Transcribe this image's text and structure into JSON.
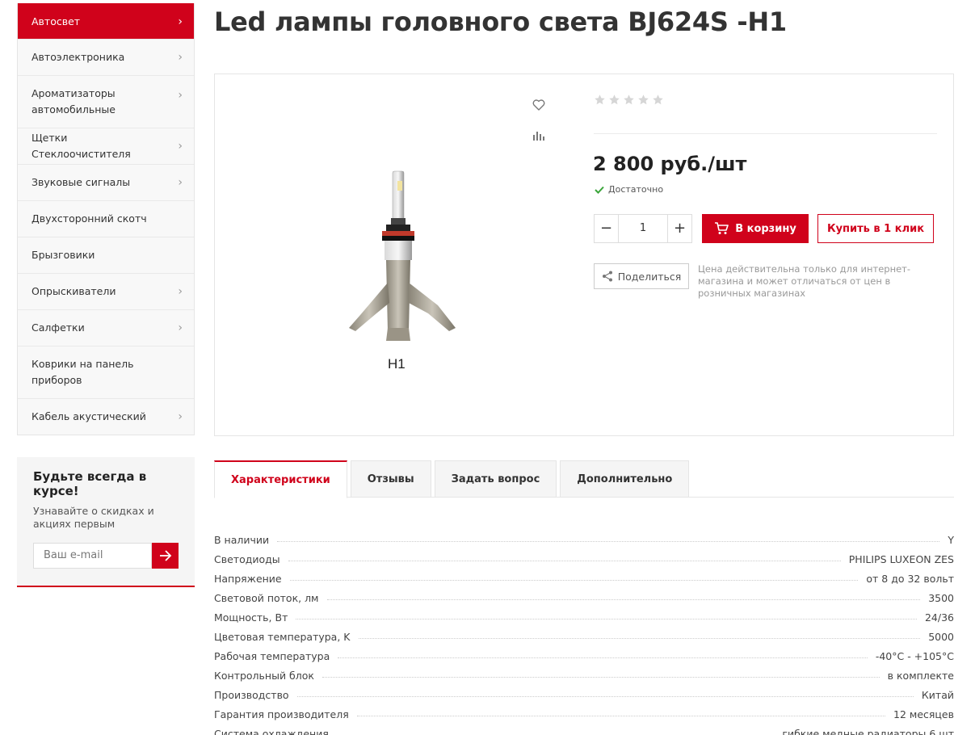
{
  "sidebar": {
    "menu": [
      {
        "label": "Автосвет",
        "active": true,
        "chevron": true
      },
      {
        "label": "Автоэлектроника",
        "chevron": true
      },
      {
        "label": "Ароматизаторы автомобильные",
        "chevron": true
      },
      {
        "label": "Щетки Стеклоочистителя",
        "chevron": true
      },
      {
        "label": "Звуковые сигналы",
        "chevron": true
      },
      {
        "label": "Двухсторонний скотч",
        "chevron": false
      },
      {
        "label": "Брызговики",
        "chevron": false
      },
      {
        "label": "Опрыскиватели",
        "chevron": true
      },
      {
        "label": "Салфетки",
        "chevron": true
      },
      {
        "label": "Коврики на панель приборов",
        "chevron": false
      },
      {
        "label": "Кабель акустический",
        "chevron": true
      }
    ],
    "subscribe": {
      "title": "Будьте всегда в курсе!",
      "text": "Узнавайте о скидках и акциях первым",
      "placeholder": "Ваш e-mail"
    }
  },
  "product": {
    "title": "Led лампы головного света BJ624S -H1",
    "image_label": "H1",
    "rating": 0,
    "rating_max": 5,
    "price": "2 800 руб./шт",
    "stock": "Достаточно",
    "quantity": "1",
    "cart_label": "В корзину",
    "oneclick_label": "Купить в 1 клик",
    "share_label": "Поделиться",
    "note": "Цена действительна только для интернет-магазина и может отличаться от цен в розничных магазинах"
  },
  "tabs": [
    {
      "label": "Характеристики",
      "active": true
    },
    {
      "label": "Отзывы"
    },
    {
      "label": "Задать вопрос"
    },
    {
      "label": "Дополнительно"
    }
  ],
  "specs": [
    {
      "label": "В наличии",
      "value": "Y"
    },
    {
      "label": "Светодиоды",
      "value": "PHILIPS LUXEON ZES"
    },
    {
      "label": "Напряжение",
      "value": "от 8 до 32 вольт"
    },
    {
      "label": "Световой поток, лм",
      "value": "3500"
    },
    {
      "label": "Мощность, Вт",
      "value": "24/36"
    },
    {
      "label": "Цветовая температура, K",
      "value": "5000"
    },
    {
      "label": "Рабочая температура",
      "value": "-40°C - +105°C"
    },
    {
      "label": "Контрольный блок",
      "value": "в комплекте"
    },
    {
      "label": "Производство",
      "value": "Китай"
    },
    {
      "label": "Гарантия производителя",
      "value": "12 месяцев"
    },
    {
      "label": "Система охлаждения",
      "value": "гибкие медные радиаторы 6 шт"
    }
  ],
  "colors": {
    "accent": "#d0021b",
    "star": "#d6d6d6",
    "check": "#3aa53a"
  }
}
